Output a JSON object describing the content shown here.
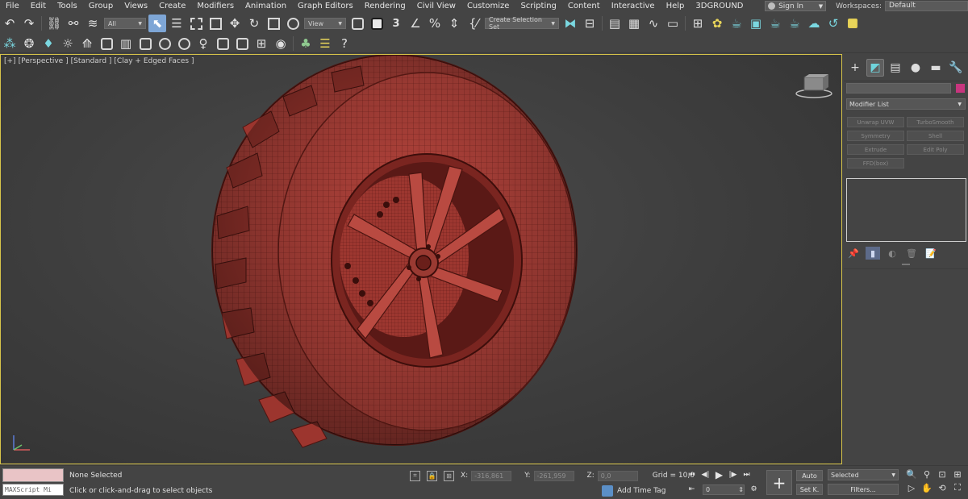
{
  "menubar": {
    "items": [
      "File",
      "Edit",
      "Tools",
      "Group",
      "Views",
      "Create",
      "Modifiers",
      "Animation",
      "Graph Editors",
      "Rendering",
      "Civil View",
      "Customize",
      "Scripting",
      "Content",
      "Interactive",
      "Help",
      "3DGROUND"
    ],
    "sign_in": "Sign In",
    "workspaces_label": "Workspaces:",
    "workspace_value": "Default"
  },
  "toolbar": {
    "selection_filter": "All",
    "ref_coord": "View",
    "selection_set": "Create Selection Set",
    "percent_snap": "%"
  },
  "viewport": {
    "label_parts": [
      "[+]",
      "[Perspective ]",
      "[Standard ]",
      "[Clay + Edged Faces ]"
    ],
    "mesh_color": "#b5443c",
    "border_color": "#d7c44a"
  },
  "command_panel": {
    "color_swatch": "#c8357e",
    "modifier_list": "Modifier List",
    "modifier_buttons": [
      "Unwrap UVW",
      "TurboSmooth",
      "Symmetry",
      "Shell",
      "Extrude",
      "Edit Poly",
      "FFD(box)"
    ]
  },
  "status": {
    "selection": "None Selected",
    "prompt": "Click or click-and-drag to select objects",
    "maxscript": "MAXScript Mi",
    "x_label": "X:",
    "x_value": "-316,861",
    "y_label": "Y:",
    "y_value": "-261,959",
    "z_label": "Z:",
    "z_value": "0,0",
    "grid": "Grid = 10,0",
    "add_time_tag": "Add Time Tag",
    "frame": "0",
    "auto": "Auto",
    "set_key": "Set K.",
    "selected": "Selected",
    "filters": "Filters..."
  }
}
